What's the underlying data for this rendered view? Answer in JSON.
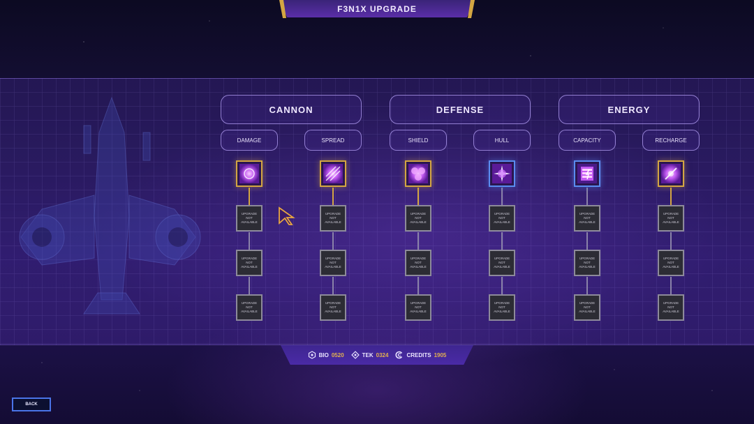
{
  "title": "F3N1X UPGRADE",
  "categories": [
    {
      "name": "CANNON",
      "subs": [
        {
          "name": "DAMAGE",
          "icon_name": "swirl-orb-icon",
          "icon_border": "gold"
        },
        {
          "name": "SPREAD",
          "icon_name": "spread-beams-icon",
          "icon_border": "gold"
        }
      ]
    },
    {
      "name": "DEFENSE",
      "subs": [
        {
          "name": "SHIELD",
          "icon_name": "hex-shield-icon",
          "icon_border": "gold"
        },
        {
          "name": "HULL",
          "icon_name": "starburst-icon",
          "icon_border": "blue"
        }
      ]
    },
    {
      "name": "ENERGY",
      "subs": [
        {
          "name": "CAPACITY",
          "icon_name": "battery-bolt-icon",
          "icon_border": "blue"
        },
        {
          "name": "RECHARGE",
          "icon_name": "energy-burst-icon",
          "icon_border": "gold"
        }
      ]
    }
  ],
  "locked_label": "UPGRADE NOT AVAILABLE",
  "resources": [
    {
      "name": "BIO",
      "value": "0520",
      "icon_name": "bio-hex-icon"
    },
    {
      "name": "TEK",
      "value": "0324",
      "icon_name": "tek-chip-icon"
    },
    {
      "name": "CREDITS",
      "value": "1905",
      "icon_name": "credits-coin-icon"
    }
  ],
  "back_label": "BACK",
  "colors": {
    "gold": "#d4a642",
    "blue": "#5a8cf0",
    "accent_value": "#e2b050"
  }
}
